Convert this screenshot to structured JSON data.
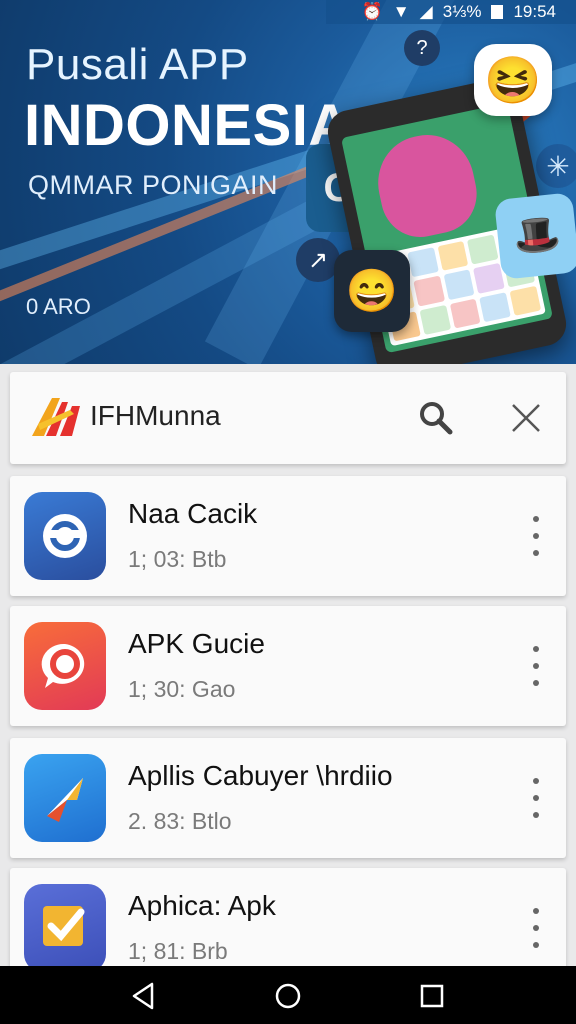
{
  "status_bar": {
    "battery_text": "3⅓%",
    "time": "19:54"
  },
  "banner": {
    "title_line1": "Pusali APP",
    "title_line2": "INDONESIA",
    "subtitle": "QMMAR PONIGAIN",
    "footer": "0 ARO"
  },
  "search": {
    "query": "IFHMunna"
  },
  "apps": [
    {
      "name": "Naa Cacik",
      "size": "1; 03: Btb",
      "color": "#2e64b4",
      "icon": "refresh-app-icon"
    },
    {
      "name": "APK Gucie",
      "size": "1; 30: Gao",
      "color": "#e8443c",
      "icon": "chat-app-icon"
    },
    {
      "name": "Apllis Cabuyer \\hrdiio",
      "size": "2. 83: Btlo",
      "color": "#2a8de4",
      "icon": "plane-app-icon"
    },
    {
      "name": "Aphica: Apk",
      "size": "1; 81: Brb",
      "color": "#f2b531",
      "icon": "check-app-icon"
    }
  ],
  "colors": {
    "banner": "#144a84",
    "accent_orange": "#e5512e",
    "card_bg": "#fafafa",
    "page_bg": "#e9e9ea"
  }
}
